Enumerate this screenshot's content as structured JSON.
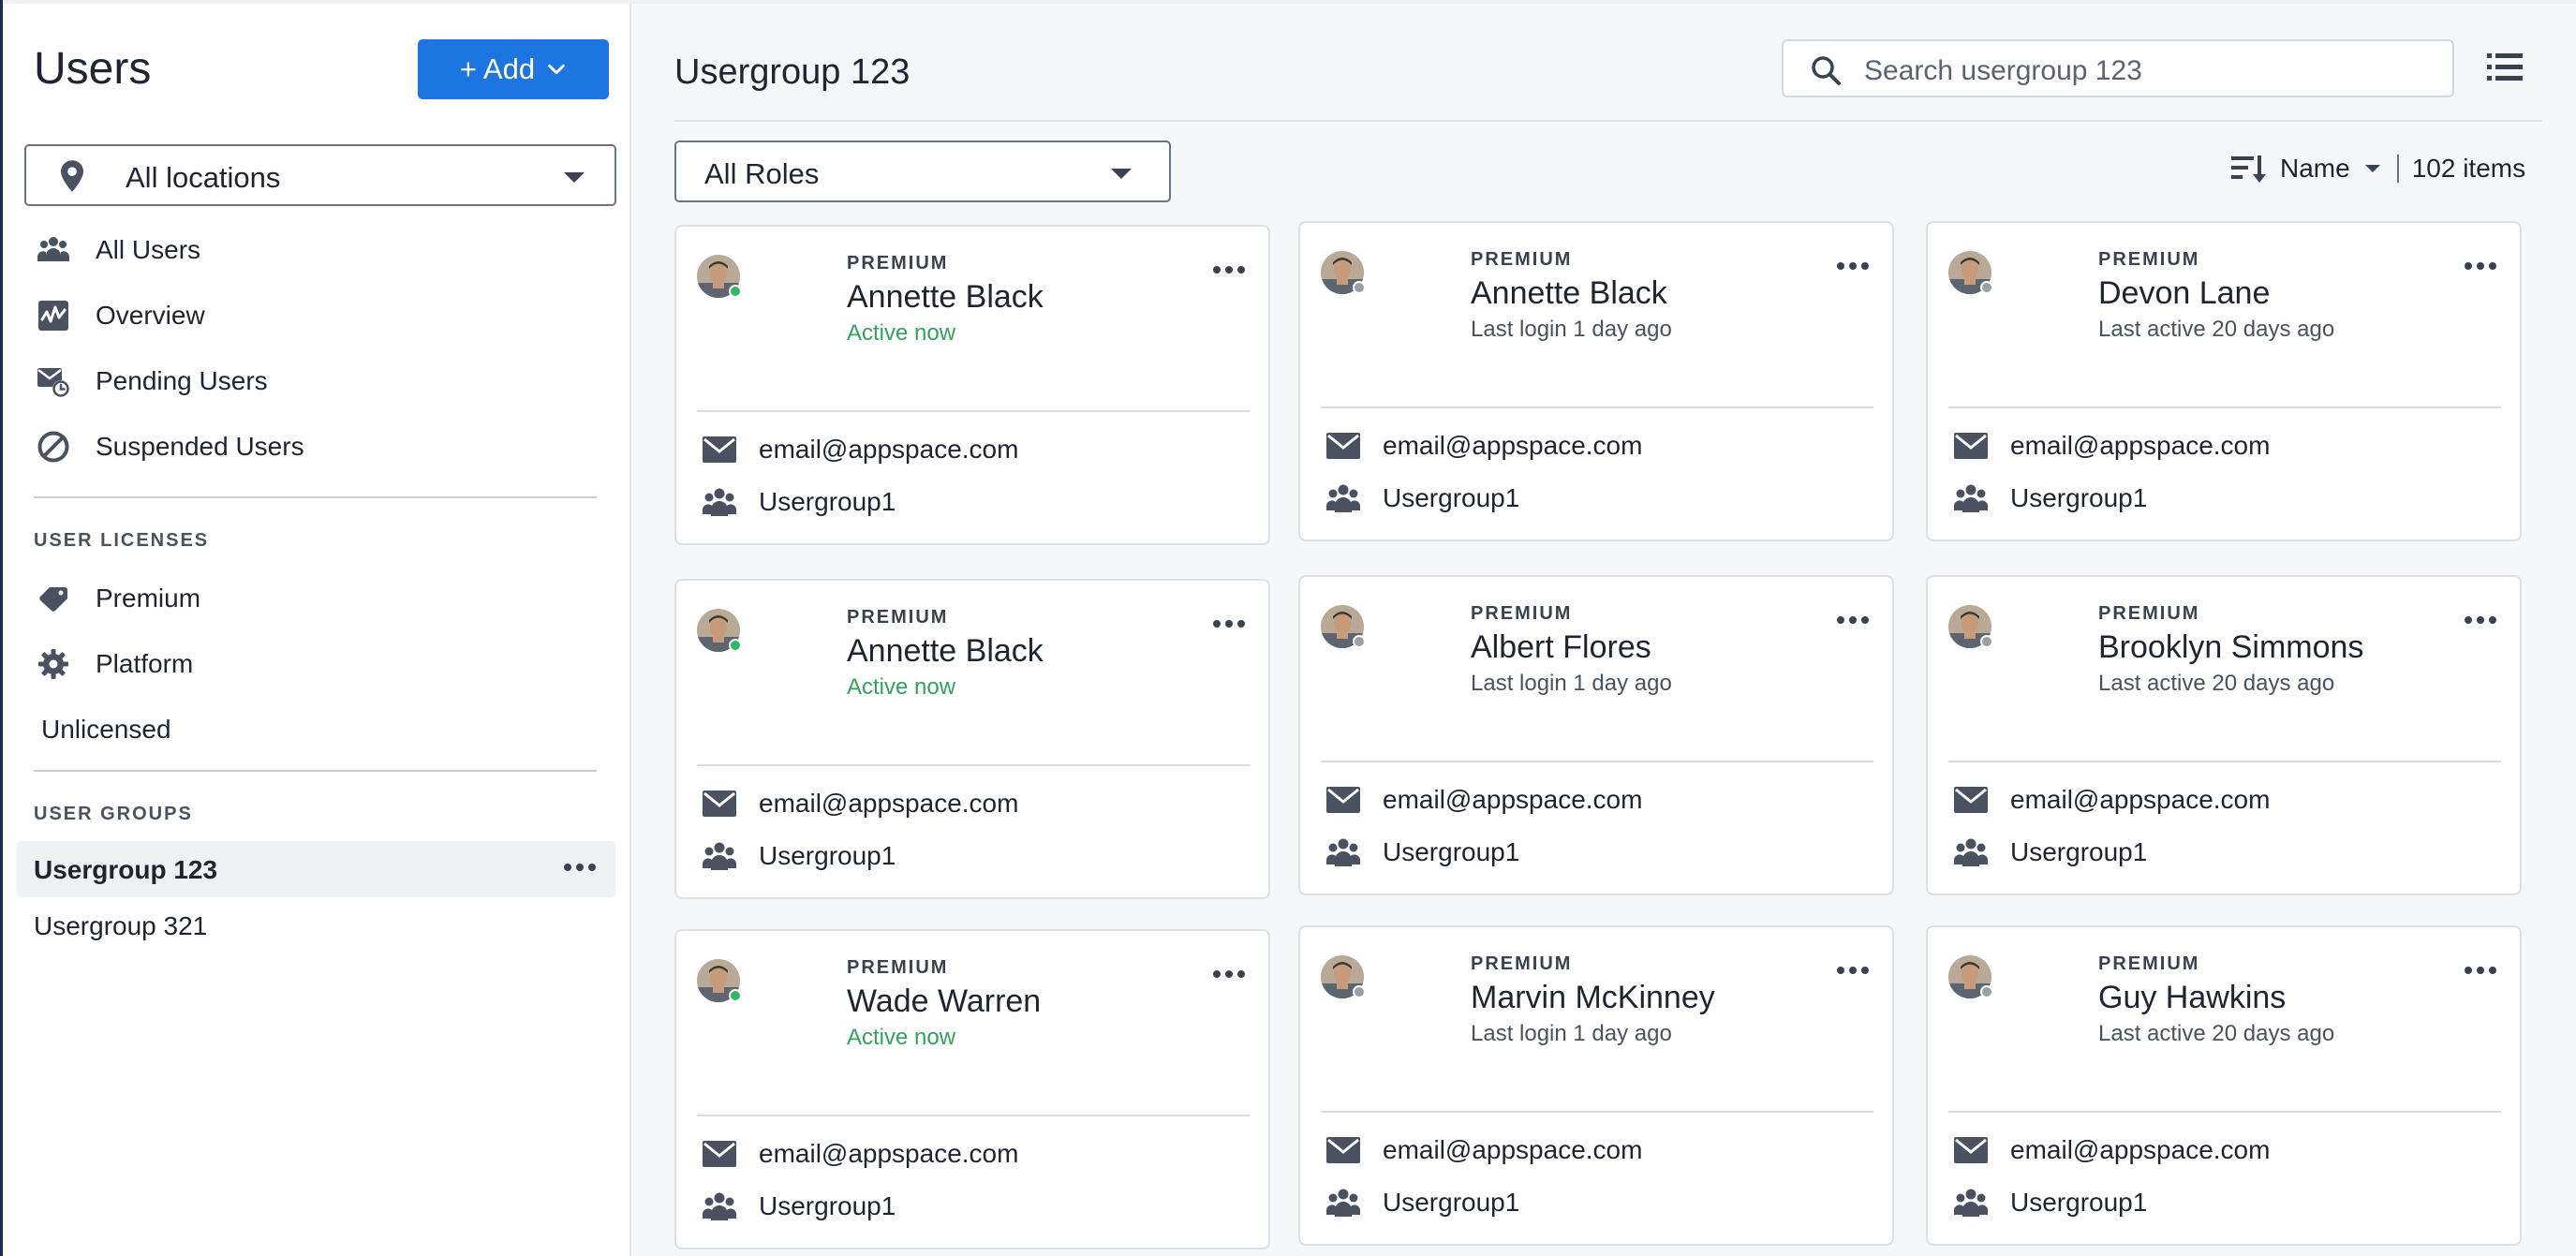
{
  "sidebar": {
    "title": "Users",
    "add_button": "+ Add",
    "location_select": "All locations",
    "nav": [
      {
        "label": "All Users",
        "icon": "users-icon"
      },
      {
        "label": "Overview",
        "icon": "activity-chart-icon"
      },
      {
        "label": "Pending Users",
        "icon": "pending-mail-icon"
      },
      {
        "label": "Suspended Users",
        "icon": "ban-icon"
      }
    ],
    "licenses_label": "USER LICENSES",
    "licenses": [
      {
        "label": "Premium",
        "icon": "gem-icon"
      },
      {
        "label": "Platform",
        "icon": "gear-icon"
      },
      {
        "label": "Unlicensed",
        "icon": ""
      }
    ],
    "groups_label": "USER GROUPS",
    "groups": [
      {
        "label": "Usergroup 123",
        "active": true
      },
      {
        "label": "Usergroup 321",
        "active": false
      }
    ]
  },
  "main": {
    "title": "Usergroup 123",
    "search_placeholder": "Search usergroup 123",
    "role_select": "All Roles",
    "sort_label": "Name",
    "item_count": "102 items"
  },
  "colors": {
    "accent": "#1c75e0",
    "online": "#2fb866",
    "offline": "#9aa0a8",
    "active_text": "#2fa35c",
    "muted_text": "#4a5160"
  },
  "cards": [
    {
      "tier": "PREMIUM",
      "name": "Annette Black",
      "status": "Active now",
      "online": true,
      "email": "email@appspace.com",
      "group": "Usergroup1"
    },
    {
      "tier": "PREMIUM",
      "name": "Annette Black",
      "status": "Last login 1 day ago",
      "online": false,
      "email": "email@appspace.com",
      "group": "Usergroup1"
    },
    {
      "tier": "PREMIUM",
      "name": "Devon Lane",
      "status": "Last active 20 days ago",
      "online": false,
      "email": "email@appspace.com",
      "group": "Usergroup1"
    },
    {
      "tier": "PREMIUM",
      "name": "Annette Black",
      "status": "Active now",
      "online": true,
      "email": "email@appspace.com",
      "group": "Usergroup1"
    },
    {
      "tier": "PREMIUM",
      "name": "Albert Flores",
      "status": "Last login 1 day ago",
      "online": false,
      "email": "email@appspace.com",
      "group": "Usergroup1"
    },
    {
      "tier": "PREMIUM",
      "name": "Brooklyn Simmons",
      "status": "Last active 20 days ago",
      "online": false,
      "email": "email@appspace.com",
      "group": "Usergroup1"
    },
    {
      "tier": "PREMIUM",
      "name": "Wade Warren",
      "status": "Active now",
      "online": true,
      "email": "email@appspace.com",
      "group": "Usergroup1"
    },
    {
      "tier": "PREMIUM",
      "name": "Marvin McKinney",
      "status": "Last login 1 day ago",
      "online": false,
      "email": "email@appspace.com",
      "group": "Usergroup1"
    },
    {
      "tier": "PREMIUM",
      "name": "Guy Hawkins",
      "status": "Last active 20 days ago",
      "online": false,
      "email": "email@appspace.com",
      "group": "Usergroup1"
    }
  ]
}
